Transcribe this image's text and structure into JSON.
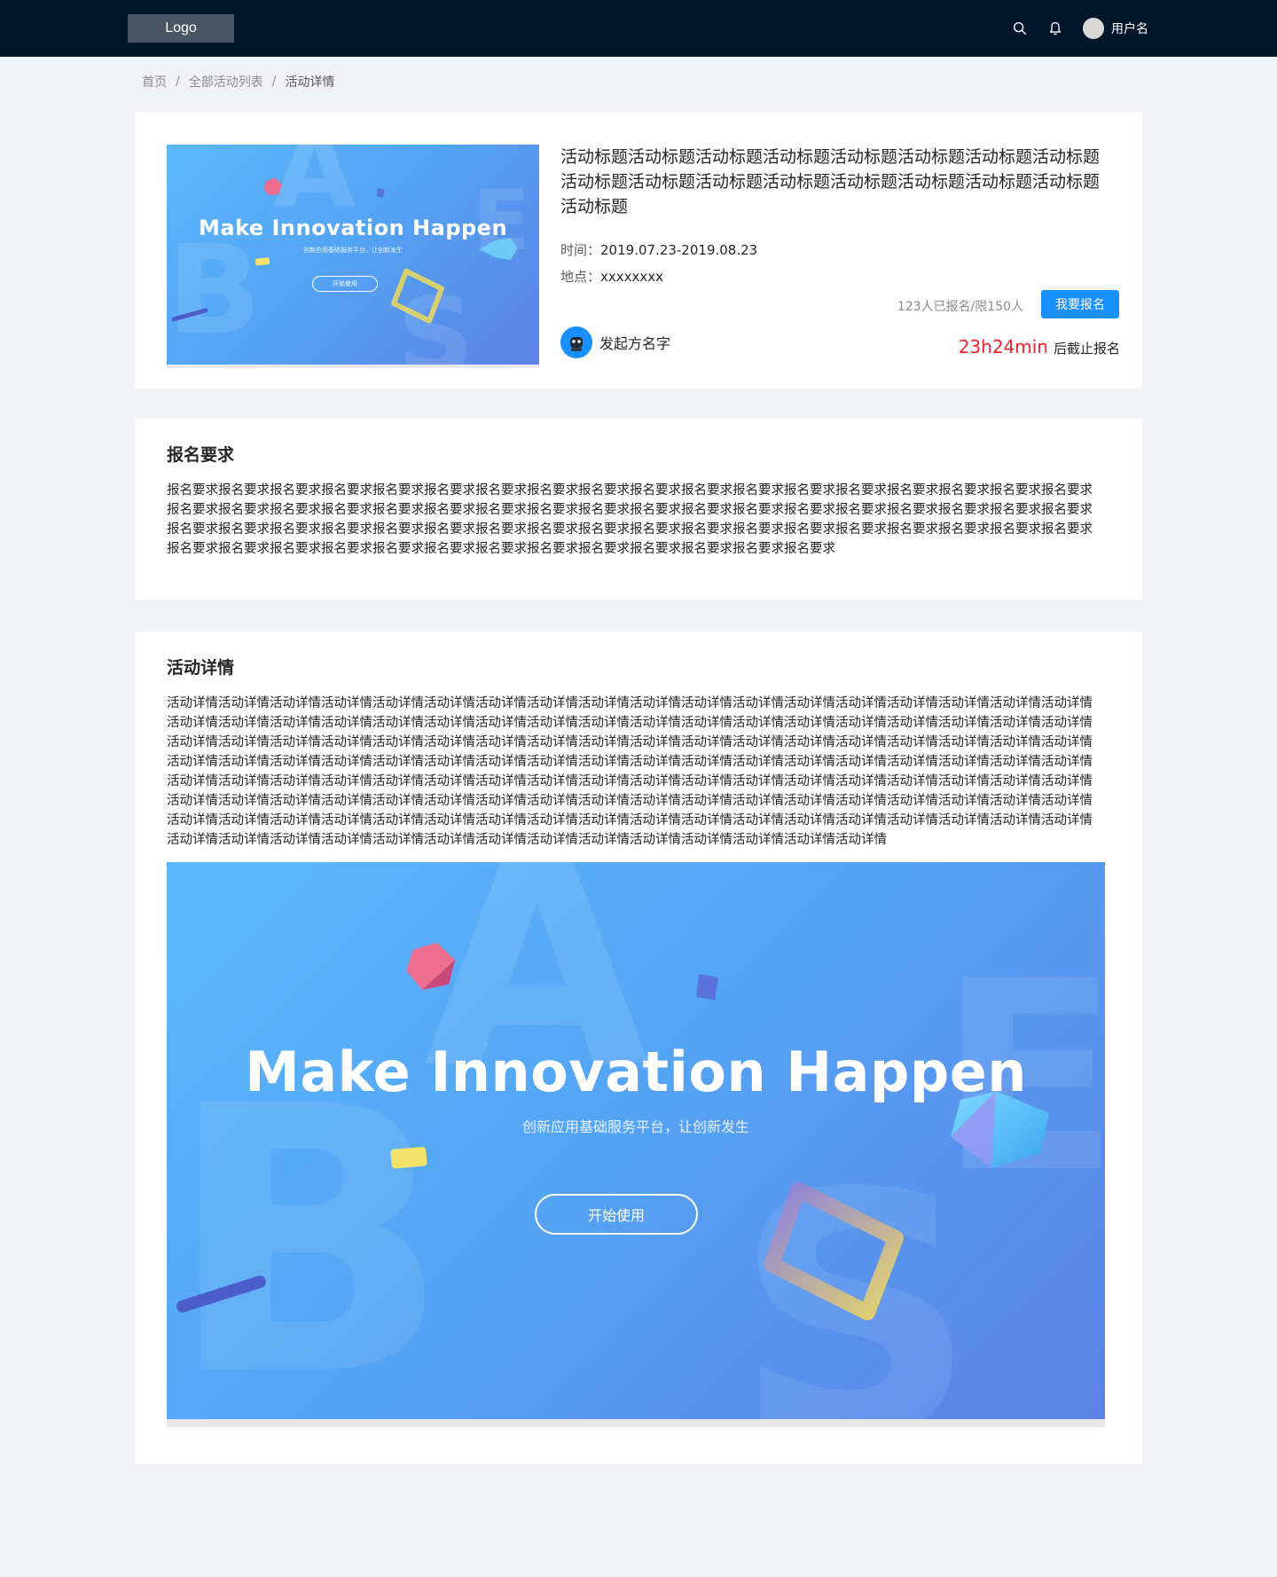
{
  "header": {
    "logo": "Logo",
    "user_name": "用户名",
    "bg_color": "#001529",
    "search_icon": "search-icon",
    "bell_icon": "bell-icon"
  },
  "breadcrumb": {
    "items": [
      "首页",
      "全部活动列表",
      "活动详情"
    ],
    "separator": "/"
  },
  "event": {
    "title": "活动标题活动标题活动标题活动标题活动标题活动标题活动标题活动标题活动标题活动标题活动标题活动标题活动标题活动标题活动标题活动标题活动标题",
    "time_label": "时间：",
    "time_value": "2019.07.23-2019.08.23",
    "place_label": "地点：",
    "place_value": "xxxxxxxx",
    "signup_count": "123人已报名/限150人",
    "signup_button": "我要报名",
    "organizer": "发起方名字",
    "deadline_time": "23h24min",
    "deadline_suffix": "后截止报名",
    "accent_color": "#1890ff",
    "deadline_color": "#f5222d"
  },
  "banner": {
    "title": "Make Innovation Happen",
    "subtitle": "创新应用基础服务平台，让创新发生",
    "button": "开始使用"
  },
  "requirements": {
    "heading": "报名要求",
    "text": "报名要求报名要求报名要求报名要求报名要求报名要求报名要求报名要求报名要求报名要求报名要求报名要求报名要求报名要求报名要求报名要求报名要求报名要求报名要求报名要求报名要求报名要求报名要求报名要求报名要求报名要求报名要求报名要求报名要求报名要求报名要求报名要求报名要求报名要求报名要求报名要求报名要求报名要求报名要求报名要求报名要求报名要求报名要求报名要求报名要求报名要求报名要求报名要求报名要求报名要求报名要求报名要求报名要求报名要求报名要求报名要求报名要求报名要求报名要求报名要求报名要求报名要求报名要求报名要求报名要求报名要求报名要求"
  },
  "details": {
    "heading": "活动详情",
    "text": "活动详情活动详情活动详情活动详情活动详情活动详情活动详情活动详情活动详情活动详情活动详情活动详情活动详情活动详情活动详情活动详情活动详情活动详情活动详情活动详情活动详情活动详情活动详情活动详情活动详情活动详情活动详情活动详情活动详情活动详情活动详情活动详情活动详情活动详情活动详情活动详情活动详情活动详情活动详情活动详情活动详情活动详情活动详情活动详情活动详情活动详情活动详情活动详情活动详情活动详情活动详情活动详情活动详情活动详情活动详情活动详情活动详情活动详情活动详情活动详情活动详情活动详情活动详情活动详情活动详情活动详情活动详情活动详情活动详情活动详情活动详情活动详情活动详情活动详情活动详情活动详情活动详情活动详情活动详情活动详情活动详情活动详情活动详情活动详情活动详情活动详情活动详情活动详情活动详情活动详情活动详情活动详情活动详情活动详情活动详情活动详情活动详情活动详情活动详情活动详情活动详情活动详情活动详情活动详情活动详情活动详情活动详情活动详情活动详情活动详情活动详情活动详情活动详情活动详情活动详情活动详情活动详情活动详情活动详情活动详情活动详情活动详情活动详情活动详情活动详情活动详情活动详情活动详情活动详情活动详情活动详情活动详情活动详情活动详情活动详情活动详情活动详情活动详情活动详情活动详情"
  }
}
